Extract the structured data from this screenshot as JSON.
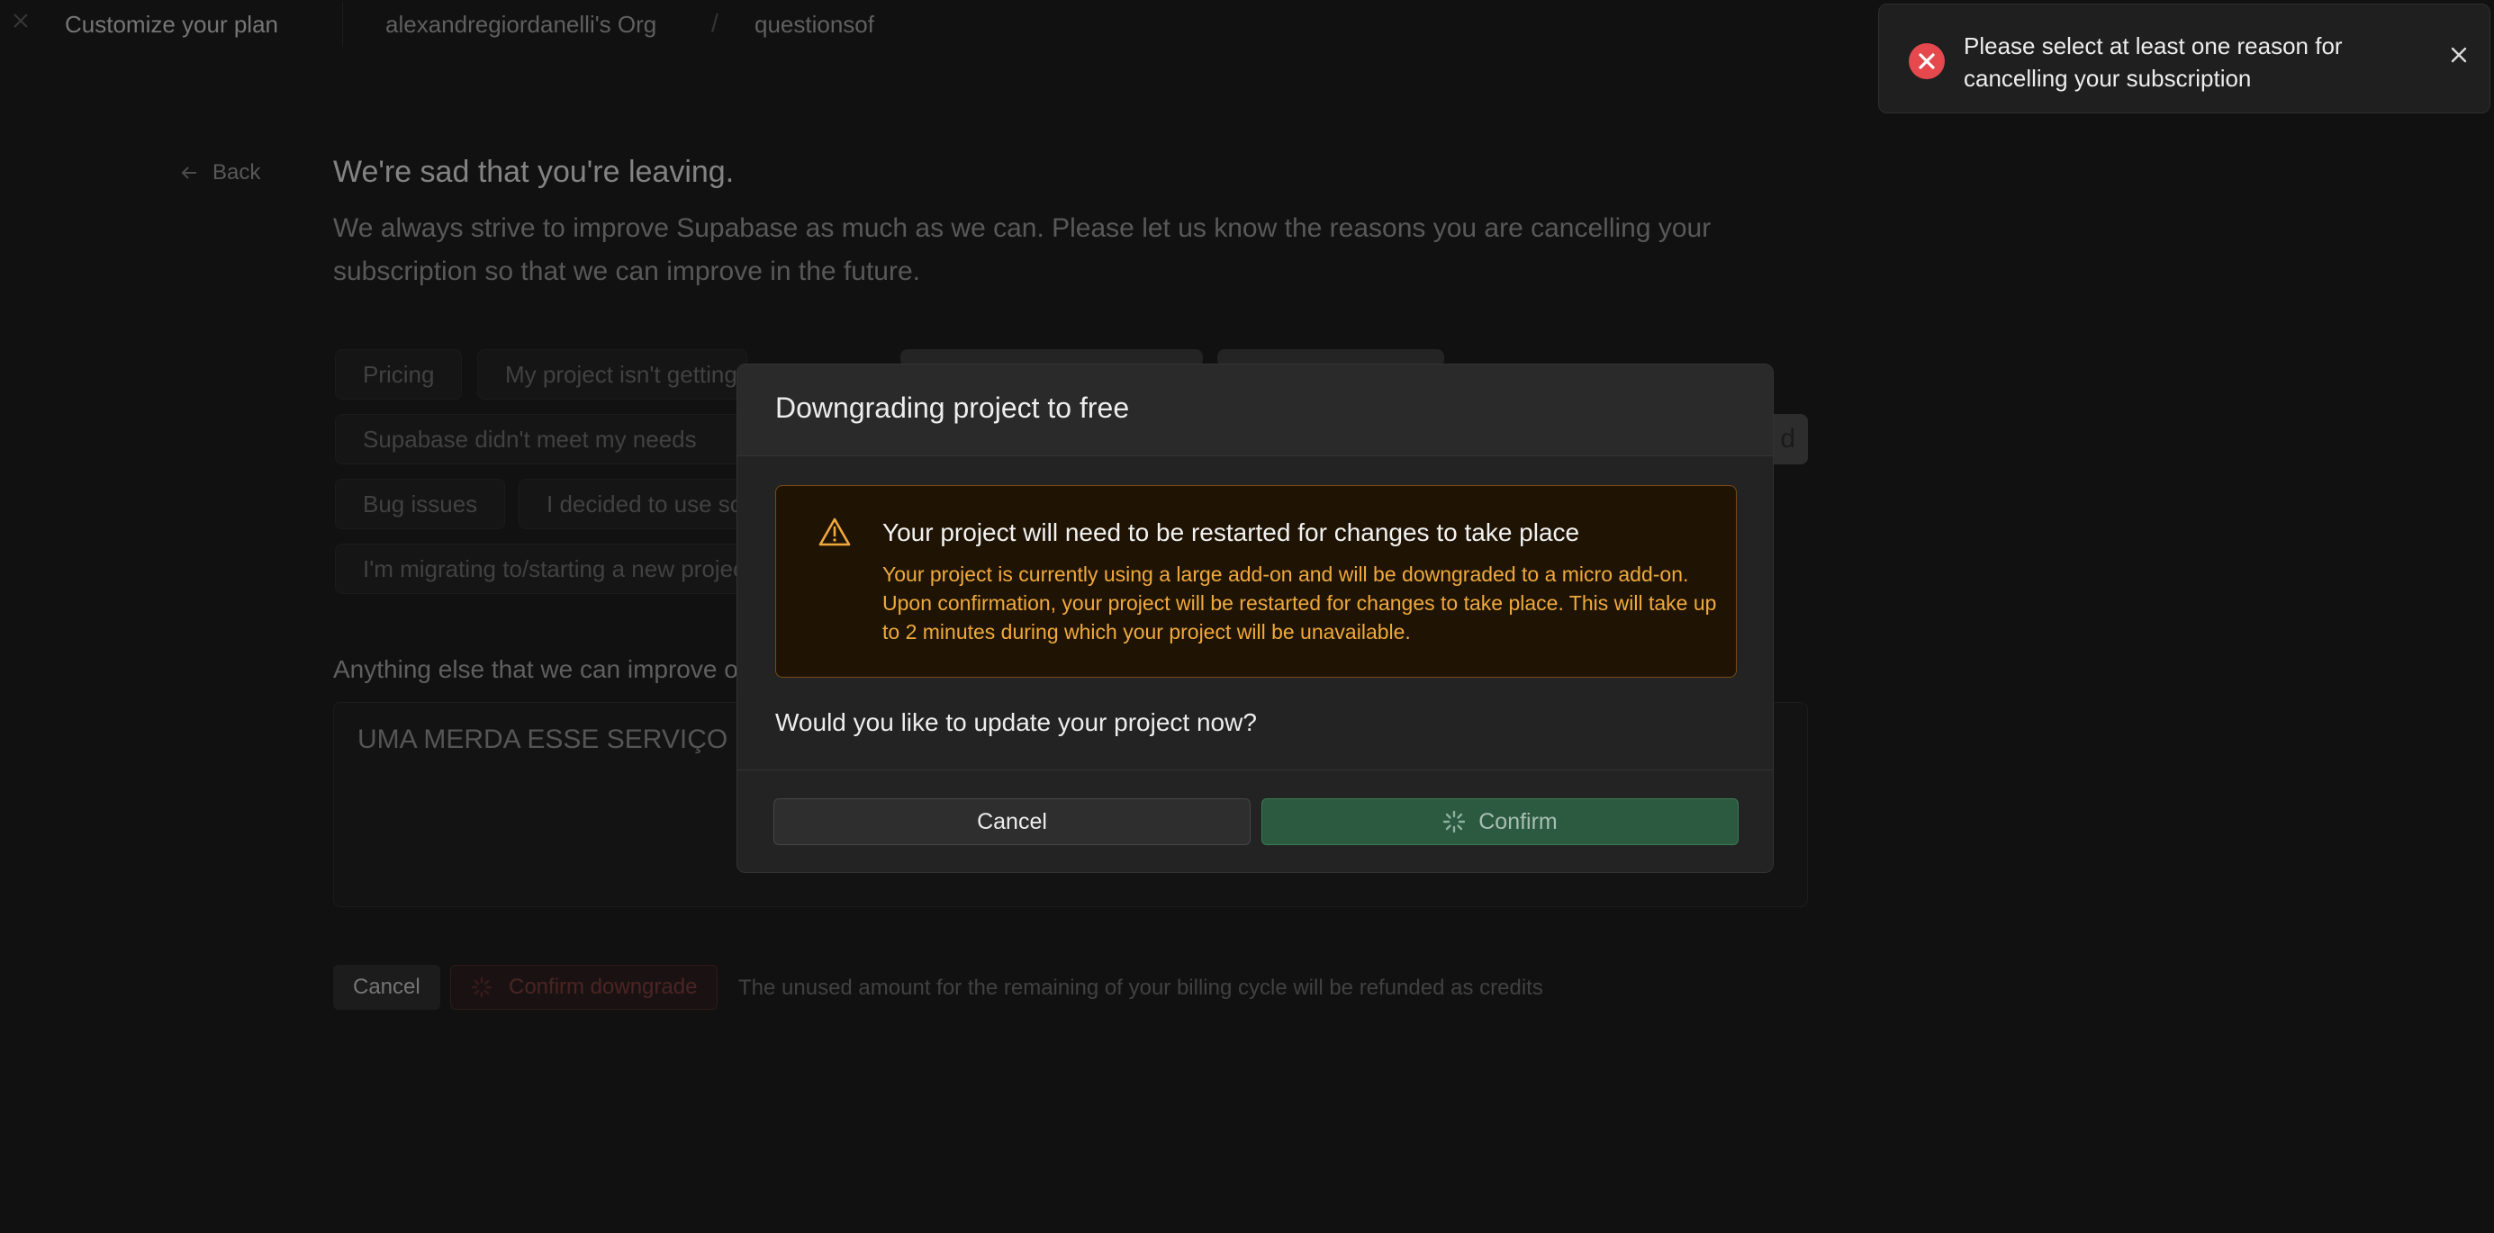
{
  "header": {
    "title": "Customize your plan",
    "org": "alexandregiordanelli's Org",
    "separator": "/",
    "project": "questionsof"
  },
  "back_label": "Back",
  "page": {
    "title": "We're sad that you're leaving.",
    "description": "We always strive to improve Supabase as much as we can. Please let us know the reasons you are cancelling your subscription so that we can improve in the future."
  },
  "reasons": [
    "Pricing",
    "My project isn't getting traction",
    "Supabase didn't meet my needs",
    "Bug issues",
    "I decided to use something else",
    "I'm migrating to/starting a new project"
  ],
  "reason_partial_right": "d",
  "improve": {
    "label": "Anything else that we can improve on?",
    "value": "UMA MERDA ESSE SERVIÇO"
  },
  "bottom": {
    "cancel_label": "Cancel",
    "confirm_label": "Confirm downgrade",
    "note": "The unused amount for the remaining of your billing cycle will be refunded as credits"
  },
  "modal": {
    "title": "Downgrading project to free",
    "alert_title": "Your project will need to be restarted for changes to take place",
    "alert_body": "Your project is currently using a large add-on and will be downgraded to a micro add-on. Upon confirmation, your project will be restarted for changes to take place. This will take up to 2 minutes during which your project will be unavailable.",
    "question": "Would you like to update your project now?",
    "cancel_label": "Cancel",
    "confirm_label": "Confirm"
  },
  "toast": {
    "message": "Please select at least one reason for cancelling your subscription"
  },
  "colors": {
    "background": "#1c1c1c",
    "brand_green": "#2b5a40",
    "warning": "#f0a93c",
    "error": "#e5484d"
  }
}
